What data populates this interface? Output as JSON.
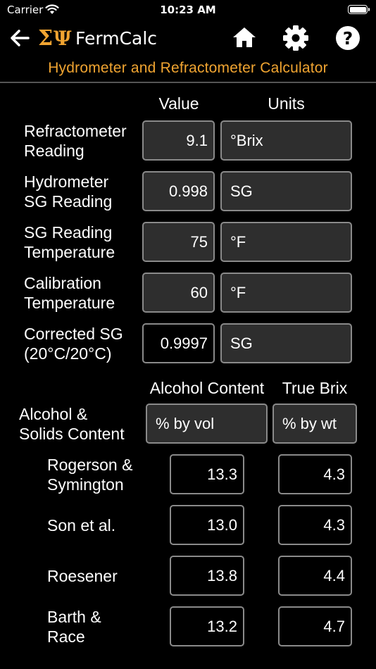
{
  "status": {
    "carrier": "Carrier",
    "time": "10:23 AM"
  },
  "nav": {
    "title": "FermCalc"
  },
  "banner": "Hydrometer and Refractometer Calculator",
  "headers": {
    "value": "Value",
    "units": "Units",
    "alcohol": "Alcohol Content",
    "truebrix": "True Brix"
  },
  "inputs": [
    {
      "label": "Refractometer\nReading",
      "value": "9.1",
      "unit": "°Brix"
    },
    {
      "label": "Hydrometer\nSG Reading",
      "value": "0.998",
      "unit": "SG"
    },
    {
      "label": "SG Reading\nTemperature",
      "value": "75",
      "unit": "°F"
    },
    {
      "label": "Calibration\nTemperature",
      "value": "60",
      "unit": "°F"
    },
    {
      "label": "Corrected SG\n(20°C/20°C)",
      "value": "0.9997",
      "unit": "SG"
    }
  ],
  "solids": {
    "label": "Alcohol &\nSolids Content",
    "alcohol_unit": "% by vol",
    "brix_unit": "% by wt"
  },
  "results": [
    {
      "label": "Rogerson &\nSymington",
      "alcohol": "13.3",
      "brix": "4.3"
    },
    {
      "label": "Son et al.",
      "alcohol": "13.0",
      "brix": "4.3"
    },
    {
      "label": "Roesener",
      "alcohol": "13.8",
      "brix": "4.4"
    },
    {
      "label": "Barth &\nRace",
      "alcohol": "13.2",
      "brix": "4.7"
    }
  ]
}
